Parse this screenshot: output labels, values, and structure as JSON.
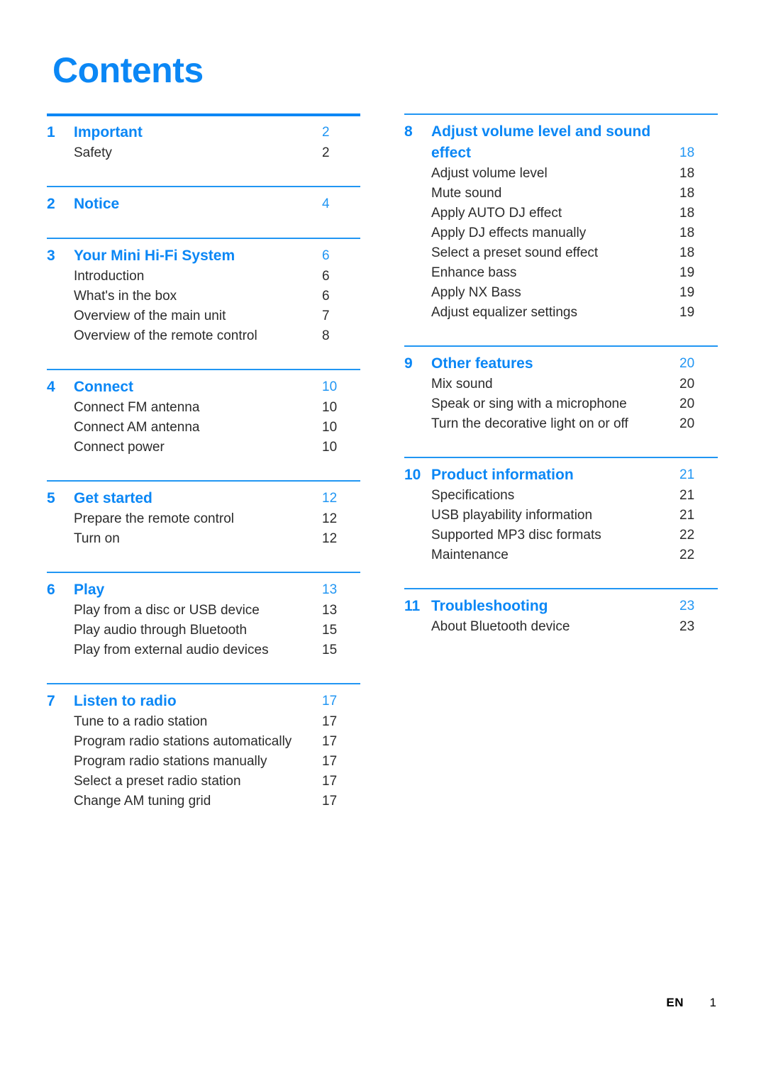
{
  "document": {
    "title": "Contents",
    "accent_color": "#0b87f5",
    "rule_color": "#2196f3",
    "body_color": "#2b2b2b"
  },
  "footer": {
    "language": "EN",
    "page_number": "1"
  },
  "columns": {
    "left": [
      {
        "number": "1",
        "title": "Important",
        "page": "2",
        "rule": "thick",
        "items": [
          {
            "label": "Safety",
            "page": "2"
          }
        ]
      },
      {
        "number": "2",
        "title": "Notice",
        "page": "4",
        "rule": "thin",
        "items": []
      },
      {
        "number": "3",
        "title": "Your Mini Hi-Fi System",
        "page": "6",
        "rule": "thin",
        "items": [
          {
            "label": "Introduction",
            "page": "6"
          },
          {
            "label": "What's in the box",
            "page": "6"
          },
          {
            "label": "Overview of the main unit",
            "page": "7"
          },
          {
            "label": "Overview of the remote control",
            "page": "8"
          }
        ]
      },
      {
        "number": "4",
        "title": "Connect",
        "page": "10",
        "rule": "thin",
        "items": [
          {
            "label": "Connect FM antenna",
            "page": "10"
          },
          {
            "label": "Connect AM antenna",
            "page": "10"
          },
          {
            "label": "Connect power",
            "page": "10"
          }
        ]
      },
      {
        "number": "5",
        "title": "Get started",
        "page": "12",
        "rule": "thin",
        "items": [
          {
            "label": "Prepare the remote control",
            "page": "12"
          },
          {
            "label": "Turn on",
            "page": "12"
          }
        ]
      },
      {
        "number": "6",
        "title": "Play",
        "page": "13",
        "rule": "thin",
        "items": [
          {
            "label": "Play from a disc or USB device",
            "page": "13"
          },
          {
            "label": "Play audio through Bluetooth",
            "page": "15"
          },
          {
            "label": "Play from external audio devices",
            "page": "15"
          }
        ]
      },
      {
        "number": "7",
        "title": "Listen to radio",
        "page": "17",
        "rule": "thin",
        "items": [
          {
            "label": "Tune to a radio station",
            "page": "17"
          },
          {
            "label": "Program radio stations automatically",
            "page": "17"
          },
          {
            "label": "Program radio stations manually",
            "page": "17"
          },
          {
            "label": "Select a preset radio station",
            "page": "17"
          },
          {
            "label": "Change AM tuning grid",
            "page": "17"
          }
        ]
      }
    ],
    "right": [
      {
        "number": "8",
        "title": "Adjust volume level and sound effect",
        "page": "18",
        "rule": "thin",
        "items": [
          {
            "label": "Adjust volume level",
            "page": "18"
          },
          {
            "label": "Mute sound",
            "page": "18"
          },
          {
            "label": "Apply AUTO DJ effect",
            "page": "18"
          },
          {
            "label": "Apply DJ effects manually",
            "page": "18"
          },
          {
            "label": "Select a preset sound effect",
            "page": "18"
          },
          {
            "label": "Enhance bass",
            "page": "19"
          },
          {
            "label": "Apply NX Bass",
            "page": "19"
          },
          {
            "label": "Adjust equalizer settings",
            "page": "19"
          }
        ]
      },
      {
        "number": "9",
        "title": "Other features",
        "page": "20",
        "rule": "thin",
        "items": [
          {
            "label": "Mix sound",
            "page": "20"
          },
          {
            "label": "Speak or sing with a microphone",
            "page": "20"
          },
          {
            "label": "Turn the decorative light on or off",
            "page": "20"
          }
        ]
      },
      {
        "number": "10",
        "title": "Product information",
        "page": "21",
        "rule": "thin",
        "items": [
          {
            "label": "Specifications",
            "page": "21"
          },
          {
            "label": "USB playability information",
            "page": "21"
          },
          {
            "label": "Supported MP3 disc formats",
            "page": "22"
          },
          {
            "label": "Maintenance",
            "page": "22"
          }
        ]
      },
      {
        "number": "11",
        "title": "Troubleshooting",
        "page": "23",
        "rule": "thin",
        "items": [
          {
            "label": "About Bluetooth device",
            "page": "23"
          }
        ]
      }
    ]
  }
}
